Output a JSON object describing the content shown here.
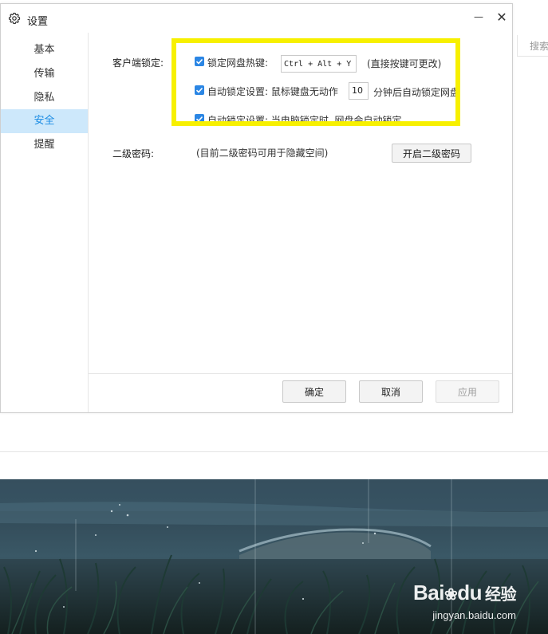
{
  "background": {
    "search_placeholder": "搜索"
  },
  "dialog": {
    "title": "设置",
    "minimize_label": "—",
    "close_label": "✕"
  },
  "sidebar": {
    "items": [
      {
        "label": "基本",
        "active": false
      },
      {
        "label": "传输",
        "active": false
      },
      {
        "label": "隐私",
        "active": false
      },
      {
        "label": "安全",
        "active": true
      },
      {
        "label": "提醒",
        "active": false
      }
    ]
  },
  "security": {
    "client_lock_label": "客户端锁定:",
    "options": [
      {
        "checked": true,
        "text": "锁定网盘热键:"
      },
      {
        "checked": true,
        "text_before": "自动锁定设置: 鼠标键盘无动作",
        "text_after": "分钟后自动锁定网盘"
      },
      {
        "checked": true,
        "text": "自动锁定设置: 当电脑锁定时, 网盘会自动锁定"
      }
    ],
    "hotkey_value": "Ctrl + Alt + Y",
    "hotkey_hint": "(直接按键可更改)",
    "idle_minutes": "10",
    "second_password_label": "二级密码:",
    "second_password_hint": "(目前二级密码可用于隐藏空间)",
    "enable_second_password_button": "开启二级密码"
  },
  "footer": {
    "ok": "确定",
    "cancel": "取消",
    "apply": "应用"
  },
  "watermark": {
    "brand": "Bai",
    "brand_paw": "du",
    "brand_cn": "经验",
    "url": "jingyan.baidu.com"
  },
  "colors": {
    "accent": "#2b86e4",
    "sidebar_active_bg": "#cde8fb",
    "highlight_box": "#f7f000"
  }
}
